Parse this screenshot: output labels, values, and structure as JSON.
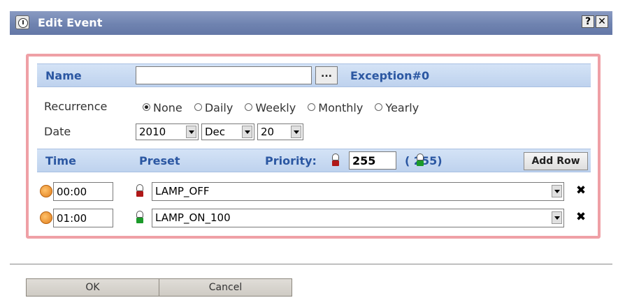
{
  "dialog": {
    "title": "Edit Event",
    "help_label": "?",
    "close_label": "✕"
  },
  "form": {
    "name_label": "Name",
    "name_value": "",
    "browse_label": "...",
    "exception_label": "Exception#0",
    "recurrence_label": "Recurrence",
    "recurrence_options": [
      "None",
      "Daily",
      "Weekly",
      "Monthly",
      "Yearly"
    ],
    "recurrence_selected": "None",
    "date_label": "Date",
    "date_year": "2010",
    "date_month": "Dec",
    "date_day": "20"
  },
  "schedule": {
    "time_header": "Time",
    "preset_header": "Preset",
    "priority_label": "Priority:",
    "priority_value": "255",
    "priority_effective": "( 255)",
    "add_row_label": "Add Row",
    "rows": [
      {
        "time": "00:00",
        "preset": "LAMP_OFF",
        "lamp": "red"
      },
      {
        "time": "01:00",
        "preset": "LAMP_ON_100",
        "lamp": "green"
      }
    ]
  },
  "footer": {
    "ok_label": "OK",
    "cancel_label": "Cancel"
  },
  "colors": {
    "titlebar": "#6f83b0",
    "panel_border": "#efa0a6",
    "header_text": "#2b57a2",
    "row_background": "#c8daf2"
  },
  "icons": [
    "clock-icon",
    "help-icon",
    "close-icon",
    "lamp-off-icon",
    "lamp-on-icon",
    "delete-icon",
    "dropdown-arrow-icon"
  ]
}
